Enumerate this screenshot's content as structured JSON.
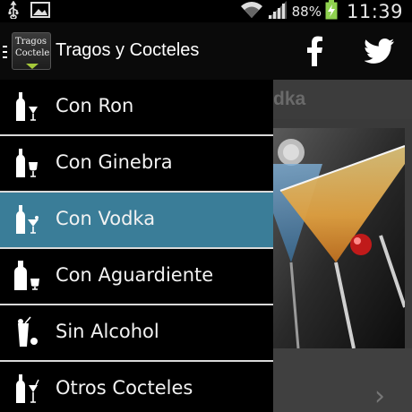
{
  "status_bar": {
    "battery_percent": "88%",
    "time": "11:39",
    "icons": [
      "usb-icon",
      "image-icon",
      "wifi-icon",
      "signal-icon",
      "battery-charging-icon"
    ]
  },
  "action_bar": {
    "logo_line1": "Tragos",
    "logo_line2": "Cocteles",
    "title": "Tragos y Cocteles",
    "icons": [
      "menu-icon",
      "facebook-icon",
      "twitter-icon"
    ]
  },
  "content": {
    "title_fragment": "dka"
  },
  "drawer": {
    "items": [
      {
        "label": "Con Ron",
        "icon": "bottle-glass-icon",
        "selected": false
      },
      {
        "label": "Con Ginebra",
        "icon": "bottle-glass-icon",
        "selected": false
      },
      {
        "label": "Con Vodka",
        "icon": "bottle-martini-icon",
        "selected": true
      },
      {
        "label": "Con Aguardiente",
        "icon": "bottle-shot-icon",
        "selected": false
      },
      {
        "label": "Sin Alcohol",
        "icon": "tall-glass-icon",
        "selected": false
      },
      {
        "label": "Otros Cocteles",
        "icon": "bottle-glass-icon",
        "selected": false
      }
    ]
  },
  "colors": {
    "selected_item": "#3a7d98",
    "drawer_bg": "#000000",
    "divider": "#d9d9d9"
  }
}
